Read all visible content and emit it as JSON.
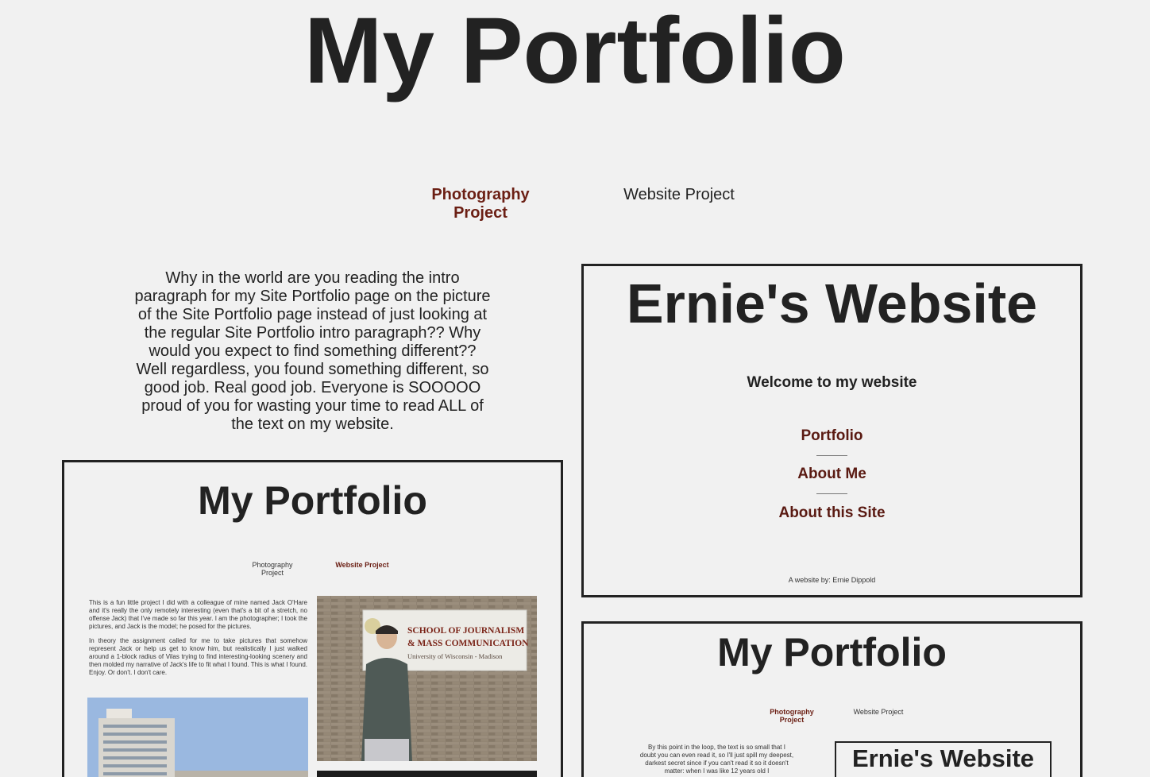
{
  "page": {
    "title": "My Portfolio",
    "nav": {
      "photography": "Photography\nProject",
      "website": "Website Project"
    },
    "intro": "Why in the world are you reading the intro paragraph for my Site Portfolio page on the picture of the Site Portfolio page instead of just looking at the regular Site Portfolio intro paragraph?? Why would you expect to find something different?? Well regardless, you found something different, so good job. Real good job. Everyone is SOOOOO proud of you for wasting your time to read ALL of the text on my website."
  },
  "left_preview": {
    "title": "My Portfolio",
    "nav_photography": "Photography\nProject",
    "nav_website": "Website Project",
    "para1": "This is a fun little project I did with a colleague of mine named Jack O'Hare and it's really the only remotely interesting (even that's a bit of a stretch, no offense Jack) that I've made so far this year. I am the photographer; I took the pictures, and Jack is the model; he posed for the pictures.",
    "para2": "In theory the assignment called for me to take pictures that somehow represent Jack or help us get to know him, but realistically I just walked around a 1-block radius of Vilas trying to find interesting-looking scenery and then molded my narrative of Jack's life to fit what I found. This is what I found. Enjoy. Or don't. I don't care.",
    "sign_line1": "SCHOOL OF JOURNALISM",
    "sign_line2": "& MASS COMMUNICATION",
    "sign_line3": "University of Wisconsin - Madison"
  },
  "right_top_preview": {
    "title": "Ernie's Website",
    "welcome": "Welcome to my website",
    "links": [
      "Portfolio",
      "About Me",
      "About this Site"
    ],
    "footer": "A website by: Ernie Dippold"
  },
  "right_bottom_preview": {
    "title": "My Portfolio",
    "nav_photography": "Photography\nProject",
    "nav_website": "Website Project",
    "text": "By this point in the loop, the text is so small that I doubt you can even read it, so I'll just spill my deepest, darkest secret since if you can't read it so it doesn't matter: when I was like 12 years old I",
    "mini_title": "Ernie's Website"
  },
  "colors": {
    "accent": "#6b1f14",
    "background": "#f1f1f1",
    "text": "#222222"
  }
}
